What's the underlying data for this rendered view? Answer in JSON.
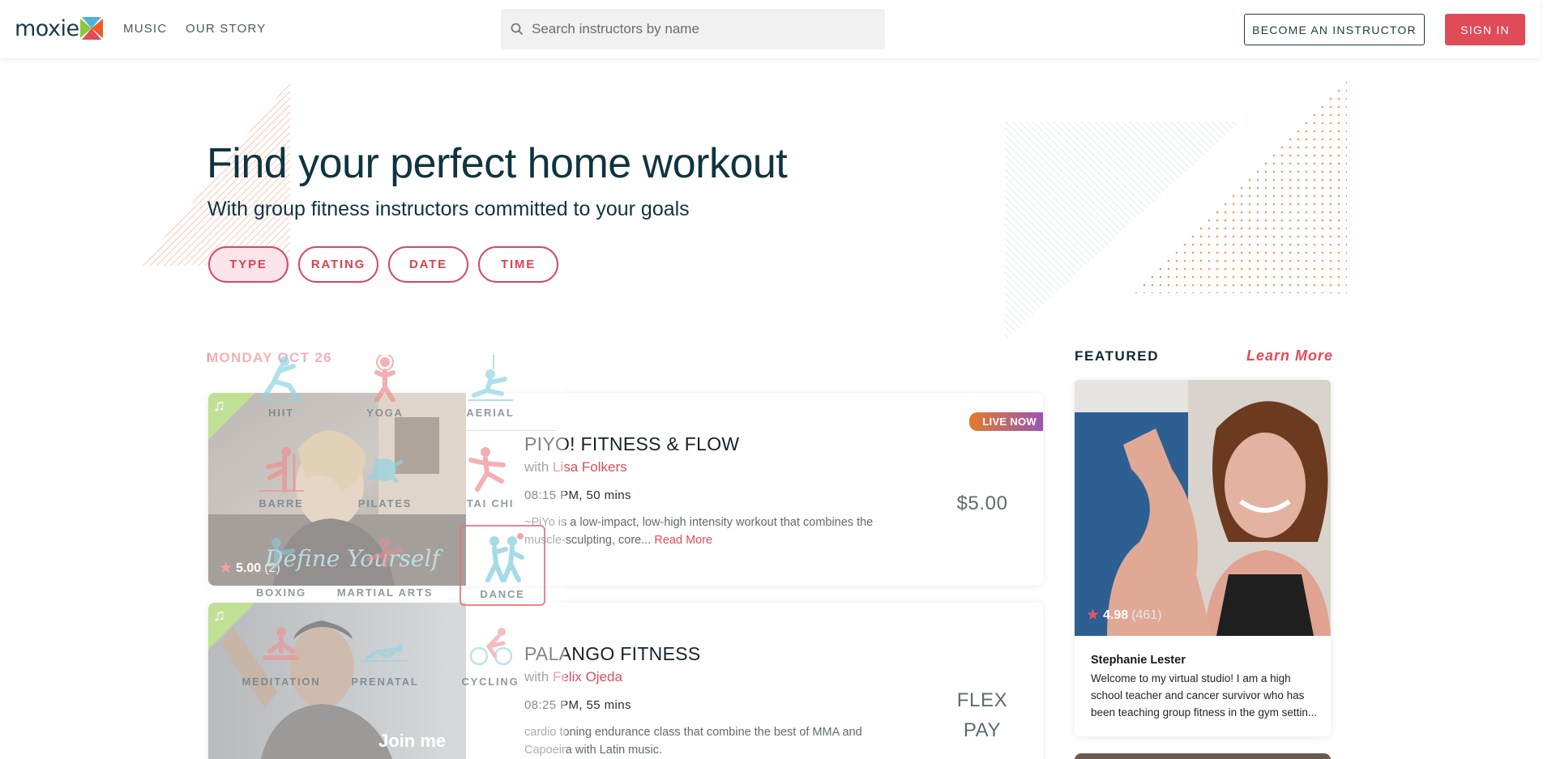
{
  "header": {
    "logo_text": "moxie",
    "nav": [
      "MUSIC",
      "OUR STORY"
    ],
    "search_placeholder": "Search instructors by name",
    "become_instructor": "BECOME AN INSTRUCTOR",
    "sign_in": "SIGN IN"
  },
  "hero": {
    "title": "Find your perfect home workout",
    "subtitle": "With group fitness instructors committed to your goals",
    "filters": [
      "TYPE",
      "RATING",
      "DATE",
      "TIME"
    ],
    "active_filter": "TYPE"
  },
  "type_menu": {
    "options": [
      "HIIT",
      "YOGA",
      "AERIAL",
      "BARRE",
      "PILATES",
      "TAI CHI",
      "BOXING",
      "MARTIAL ARTS",
      "DANCE",
      "MEDITATION",
      "PRENATAL",
      "CYCLING"
    ],
    "selected": "DANCE"
  },
  "schedule": {
    "day": "MONDAY OCT 26",
    "classes": [
      {
        "title": "PIYO! FITNESS & FLOW",
        "with": "with",
        "instructor": "Lisa Folkers",
        "time": "08:15 PM, 50 mins",
        "description": "~PiYo is a low-impact, low-high intensity workout that combines the muscle-sculpting, core...",
        "read_more": "Read More",
        "price": "$5.00",
        "rating": "5.00",
        "rating_count": "(2)",
        "image_caption": "Define Yourself",
        "badge": "LIVE NOW",
        "has_music": true
      },
      {
        "title": "PALANGO FITNESS",
        "with": "with",
        "instructor": "Felix Ojeda",
        "time": "08:25 PM, 55 mins",
        "description": "cardio toning endurance class that combine the best of MMA and Capoeira with Latin music.",
        "price_line1": "FLEX",
        "price_line2": "PAY",
        "image_caption": "Join me",
        "has_music": true
      }
    ]
  },
  "featured": {
    "heading": "FEATURED",
    "learn_more": "Learn More",
    "instructor": {
      "name": "Stephanie Lester",
      "rating": "4.98",
      "rating_count": "(461)",
      "bio": "Welcome to my virtual studio! I am a high school teacher and cancer survivor who has been teaching group fitness in the gym settin..."
    }
  },
  "colors": {
    "brand_red": "#e04b58",
    "navy": "#0f3440",
    "ribbon_green": "#8cc63f",
    "icon_blue": "#8fd3e3",
    "icon_pink": "#ef8f92"
  }
}
